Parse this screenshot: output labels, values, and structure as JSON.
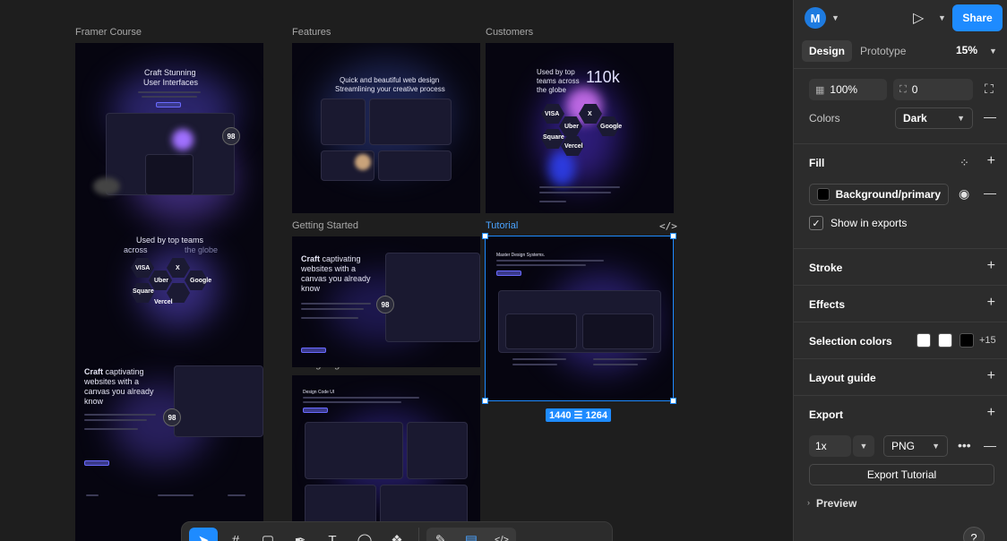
{
  "canvas": {
    "frames": [
      {
        "label": "Framer Course"
      },
      {
        "label": "Features"
      },
      {
        "label": "Customers"
      },
      {
        "label": "Getting Started"
      },
      {
        "label": "Tutorial"
      },
      {
        "label": "Changelog"
      }
    ],
    "course_frame": {
      "hero_line1": "Craft Stunning",
      "hero_line2": "User Interfaces",
      "badge": "98",
      "used_by_line1": "Used by top teams",
      "used_by_line2": "across",
      "used_by_line3": "the globe",
      "brands": [
        "VISA",
        "X",
        "Uber",
        "Google",
        "Square",
        "Vercel"
      ],
      "craft_bold": "Craft",
      "craft_rest_1": " captivating",
      "craft_rest_2": "websites with a",
      "craft_rest_3": "canvas you already",
      "craft_rest_4": "know",
      "badge2": "98"
    },
    "features_frame": {
      "title_line1": "Quick and beautiful web design",
      "title_line2": "Streamlining your creative process"
    },
    "customers_frame": {
      "used_by_line1": "Used by top",
      "used_by_line2": "teams across",
      "used_by_line3": "the globe",
      "stat": "110k",
      "brands": [
        "VISA",
        "X",
        "Uber",
        "Google",
        "Square",
        "Vercel"
      ]
    },
    "getting_started_frame": {
      "craft_bold": "Craft",
      "craft_rest_1": " captivating",
      "craft_rest_2": "websites with a",
      "craft_rest_3": "canvas you already",
      "craft_rest_4": "know",
      "badge": "98"
    },
    "tutorial_frame": {
      "heading": "Master Design Systems."
    },
    "changelog_frame": {
      "heading": "Design Code UI"
    },
    "selection": {
      "width": "1440",
      "height": "1264"
    },
    "code_glyph": "</>"
  },
  "toolbar": {
    "tools": [
      {
        "name": "move",
        "glyph": "➤"
      },
      {
        "name": "frame",
        "glyph": "#"
      },
      {
        "name": "rectangle",
        "glyph": "▢"
      },
      {
        "name": "pen",
        "glyph": "✒"
      },
      {
        "name": "text",
        "glyph": "T"
      },
      {
        "name": "comment",
        "glyph": "◯"
      },
      {
        "name": "components",
        "glyph": "❖"
      }
    ],
    "modes": [
      {
        "name": "draw",
        "glyph": "✎"
      },
      {
        "name": "design",
        "glyph": "▤"
      },
      {
        "name": "dev",
        "glyph": "</>"
      }
    ]
  },
  "panel": {
    "avatar_initial": "M",
    "share_label": "Share",
    "tabs": {
      "design": "Design",
      "prototype": "Prototype"
    },
    "zoom": "15%",
    "opacity": "100%",
    "corner_radius": "0",
    "colors_label": "Colors",
    "colors_mode": "Dark",
    "fill_title": "Fill",
    "fill_style": "Background/primary",
    "fill_swatch_color": "#000000",
    "show_in_exports": "Show in exports",
    "stroke_title": "Stroke",
    "effects_title": "Effects",
    "selection_colors_title": "Selection colors",
    "selection_colors": [
      "#ffffff",
      "#ffffff",
      "#000000"
    ],
    "selection_colors_more": "+15",
    "layout_guide_title": "Layout guide",
    "export_title": "Export",
    "export_scale": "1x",
    "export_format": "PNG",
    "export_button": "Export Tutorial",
    "preview_label": "Preview",
    "help": "?"
  },
  "colors": {
    "accent": "#1e8bff",
    "panel_bg": "#2c2c2c",
    "canvas_bg": "#1e1e1e"
  }
}
